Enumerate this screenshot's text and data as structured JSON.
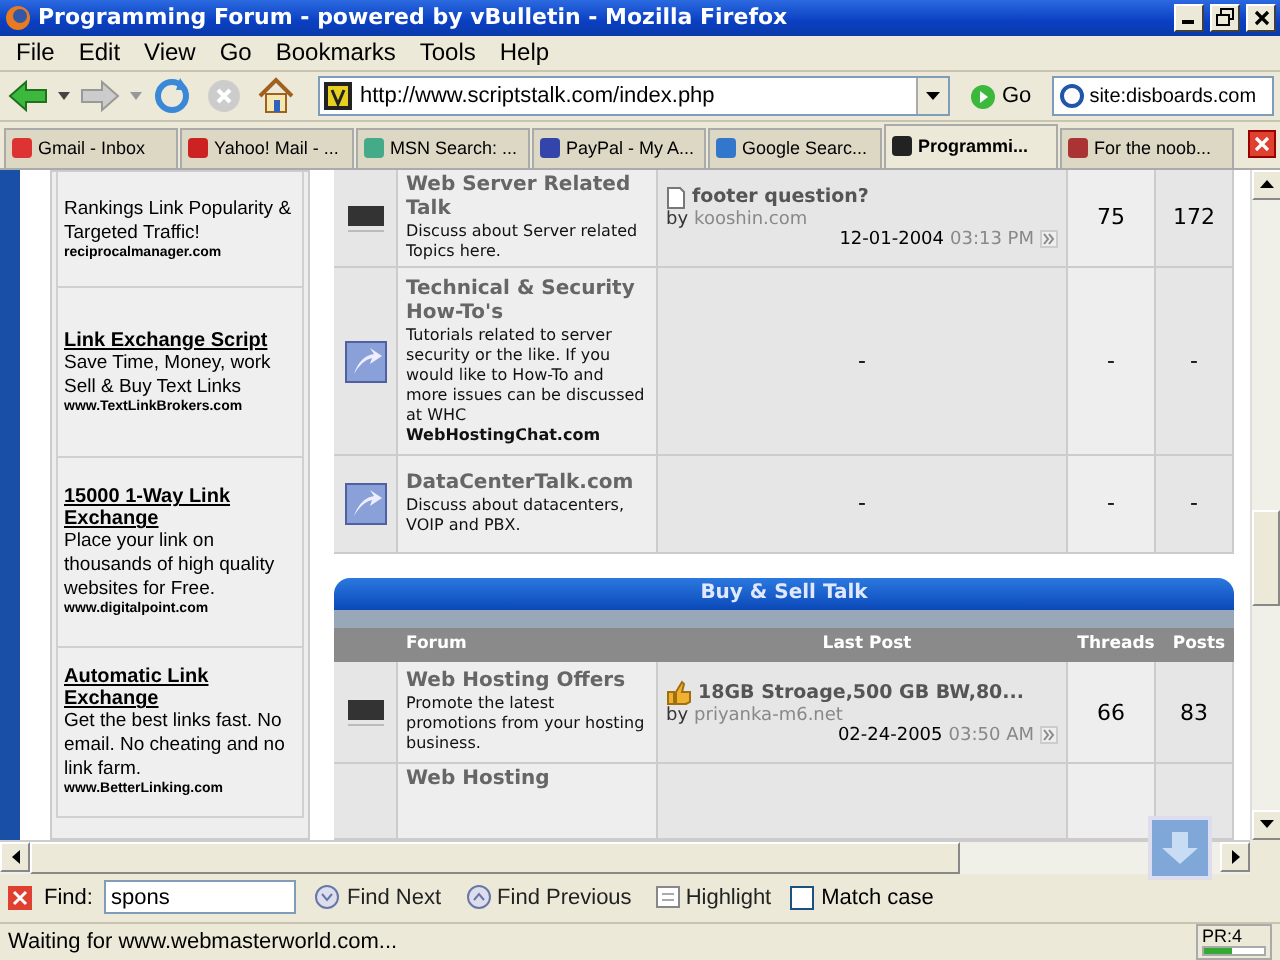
{
  "window": {
    "title": "Programming Forum - powered by vBulletin - Mozilla Firefox"
  },
  "menu": [
    "File",
    "Edit",
    "View",
    "Go",
    "Bookmarks",
    "Tools",
    "Help"
  ],
  "toolbar": {
    "address": "http://www.scriptstalk.com/index.php",
    "go": "Go",
    "search": "site:disboards.com"
  },
  "tabs": [
    {
      "label": "Gmail - Inbox",
      "selected": false
    },
    {
      "label": "Yahoo! Mail - ...",
      "selected": false
    },
    {
      "label": "MSN Search: ...",
      "selected": false
    },
    {
      "label": "PayPal - My A...",
      "selected": false
    },
    {
      "label": "Google Searc...",
      "selected": false
    },
    {
      "label": "Programmi...",
      "selected": true
    },
    {
      "label": "For the noob...",
      "selected": false
    }
  ],
  "sidebar": {
    "ads": [
      {
        "body": "Rankings Link Popularity & Targeted Traffic!",
        "url": "reciprocalmanager.com"
      },
      {
        "title": "Link Exchange Script",
        "body": "Save Time, Money, work Sell & Buy Text Links",
        "url": "www.TextLinkBrokers.com"
      },
      {
        "title": "15000 1-Way Link Exchange",
        "body": "Place your link on thousands of high quality websites for Free.",
        "url": "www.digitalpoint.com"
      },
      {
        "title": "Automatic Link Exchange",
        "body": "Get the best links fast. No email. No cheating and no link farm.",
        "url": "www.BetterLinking.com"
      }
    ]
  },
  "forum": {
    "rows": [
      {
        "kind": "dark",
        "name": "Web Server Related Talk",
        "description": "Discuss about Server related Topics here.",
        "last_post": {
          "title": "footer question?",
          "by": "by",
          "author": "kooshin.com",
          "date": "12-01-2004",
          "time": "03:13 PM"
        },
        "threads": "75",
        "posts": "172"
      },
      {
        "kind": "arrow",
        "name": "Technical & Security How-To's",
        "description": "Tutorials related to server security or the like. If you would like to How-To and more issues can be discussed at WHC **WebHostingChat.com**",
        "empty": "-",
        "threads": "-",
        "posts": "-"
      },
      {
        "kind": "arrow",
        "name": "DataCenterTalk.com",
        "description": "Discuss about datacenters, VOIP and PBX.",
        "empty": "-",
        "threads": "-",
        "posts": "-"
      }
    ],
    "section": {
      "title": "Buy & Sell Talk",
      "columns": [
        "Forum",
        "Last Post",
        "Threads",
        "Posts"
      ],
      "rows": [
        {
          "kind": "dark",
          "name": "Web Hosting Offers",
          "description": "Promote the latest promotions from your hosting business.",
          "last_post": {
            "title": "18GB Stroage,500 GB BW,80...",
            "by": "by",
            "author": "priyanka-m6.net",
            "date": "02-24-2005",
            "time": "03:50 AM"
          },
          "threads": "66",
          "posts": "83"
        },
        {
          "kind": "cut",
          "name": "Web Hosting"
        }
      ]
    }
  },
  "find_bar": {
    "label": "Find:",
    "value": "spons",
    "next": "Find Next",
    "previous": "Find Previous",
    "highlight": "Highlight",
    "match_case": {
      "label": "Match case",
      "checked": false
    }
  },
  "status_bar": {
    "text": "Waiting for www.webmasterworld.com...",
    "pagerank": {
      "label": "PR:4",
      "level": 0.45
    }
  }
}
